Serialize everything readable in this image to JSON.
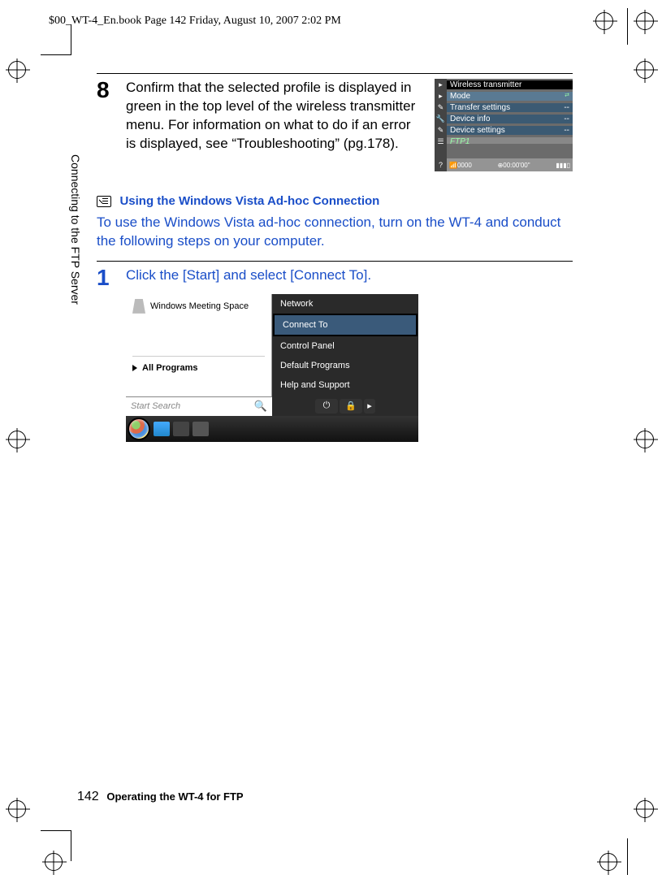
{
  "print": {
    "header": "$00_WT-4_En.book  Page 142  Friday, August 10, 2007  2:02 PM"
  },
  "sideLabel": "Connecting to the FTP Server",
  "step8": {
    "num": "8",
    "text": "Confirm that the selected profile is displayed in green in the top level of the wireless transmitter menu.  For information on what to do if an error is displayed, see “Troubleshooting” (pg.178)."
  },
  "cameraMenu": {
    "title": "Wireless transmitter",
    "items": [
      {
        "label": "Mode",
        "value": ""
      },
      {
        "label": "Transfer settings",
        "value": "--"
      },
      {
        "label": "Device info",
        "value": "--"
      },
      {
        "label": "Device settings",
        "value": "--"
      }
    ],
    "profile": "FTP1",
    "status_left": "0000",
    "status_right": "00:00'00\""
  },
  "note": {
    "title": "Using the Windows Vista Ad-hoc Connection",
    "text": "To use the Windows Vista ad-hoc connection, turn on the WT-4 and conduct the following steps on your computer."
  },
  "step1": {
    "num": "1",
    "text": "Click the [Start] and select [Connect To]."
  },
  "vista": {
    "left_item": "Windows Meeting Space",
    "all_programs": "All Programs",
    "right_items": [
      "Network",
      "Connect To",
      "Control Panel",
      "Default Programs",
      "Help and Support"
    ],
    "search_placeholder": "Start Search"
  },
  "footer": {
    "page": "142",
    "title": "Operating the WT-4 for FTP"
  }
}
